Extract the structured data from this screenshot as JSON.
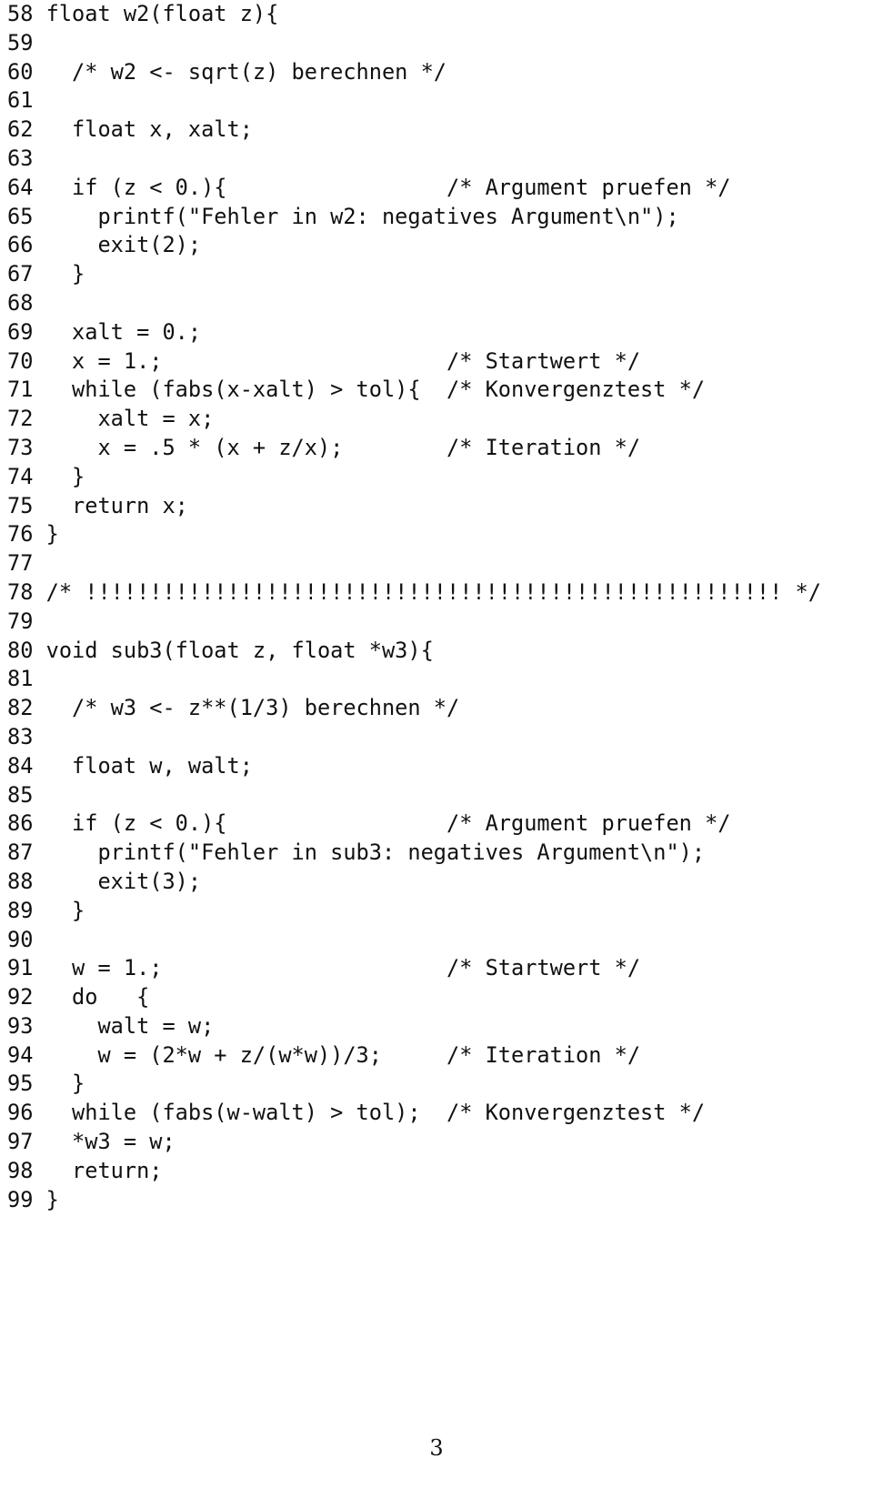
{
  "document": {
    "kind": "typeset-source-code-listing",
    "language": "C",
    "page_number": "3",
    "line_number_width": 2,
    "first_line_number": 58,
    "last_line_number": 99
  },
  "listing": {
    "lines": [
      {
        "no": "58",
        "text": "float w2(float z){"
      },
      {
        "no": "59",
        "text": ""
      },
      {
        "no": "60",
        "text": "  /* w2 <- sqrt(z) berechnen */"
      },
      {
        "no": "61",
        "text": ""
      },
      {
        "no": "62",
        "text": "  float x, xalt;"
      },
      {
        "no": "63",
        "text": ""
      },
      {
        "no": "64",
        "text": "  if (z < 0.){                 /* Argument pruefen */"
      },
      {
        "no": "65",
        "text": "    printf(\"Fehler in w2: negatives Argument\\n\");"
      },
      {
        "no": "66",
        "text": "    exit(2);"
      },
      {
        "no": "67",
        "text": "  }"
      },
      {
        "no": "68",
        "text": ""
      },
      {
        "no": "69",
        "text": "  xalt = 0.;"
      },
      {
        "no": "70",
        "text": "  x = 1.;                      /* Startwert */"
      },
      {
        "no": "71",
        "text": "  while (fabs(x-xalt) > tol){  /* Konvergenztest */"
      },
      {
        "no": "72",
        "text": "    xalt = x;"
      },
      {
        "no": "73",
        "text": "    x = .5 * (x + z/x);        /* Iteration */"
      },
      {
        "no": "74",
        "text": "  }"
      },
      {
        "no": "75",
        "text": "  return x;"
      },
      {
        "no": "76",
        "text": "}"
      },
      {
        "no": "77",
        "text": ""
      },
      {
        "no": "78",
        "text": "/* !!!!!!!!!!!!!!!!!!!!!!!!!!!!!!!!!!!!!!!!!!!!!!!!!!!!!! */"
      },
      {
        "no": "79",
        "text": ""
      },
      {
        "no": "80",
        "text": "void sub3(float z, float *w3){"
      },
      {
        "no": "81",
        "text": ""
      },
      {
        "no": "82",
        "text": "  /* w3 <- z**(1/3) berechnen */"
      },
      {
        "no": "83",
        "text": ""
      },
      {
        "no": "84",
        "text": "  float w, walt;"
      },
      {
        "no": "85",
        "text": ""
      },
      {
        "no": "86",
        "text": "  if (z < 0.){                 /* Argument pruefen */"
      },
      {
        "no": "87",
        "text": "    printf(\"Fehler in sub3: negatives Argument\\n\");"
      },
      {
        "no": "88",
        "text": "    exit(3);"
      },
      {
        "no": "89",
        "text": "  }"
      },
      {
        "no": "90",
        "text": ""
      },
      {
        "no": "91",
        "text": "  w = 1.;                      /* Startwert */"
      },
      {
        "no": "92",
        "text": "  do   {"
      },
      {
        "no": "93",
        "text": "    walt = w;"
      },
      {
        "no": "94",
        "text": "    w = (2*w + z/(w*w))/3;     /* Iteration */"
      },
      {
        "no": "95",
        "text": "  }"
      },
      {
        "no": "96",
        "text": "  while (fabs(w-walt) > tol);  /* Konvergenztest */"
      },
      {
        "no": "97",
        "text": "  *w3 = w;"
      },
      {
        "no": "98",
        "text": "  return;"
      },
      {
        "no": "99",
        "text": "}"
      }
    ]
  },
  "footer": {
    "page_label": "3"
  },
  "colors": {
    "page_background": "#ffffff",
    "text": "#111111"
  }
}
